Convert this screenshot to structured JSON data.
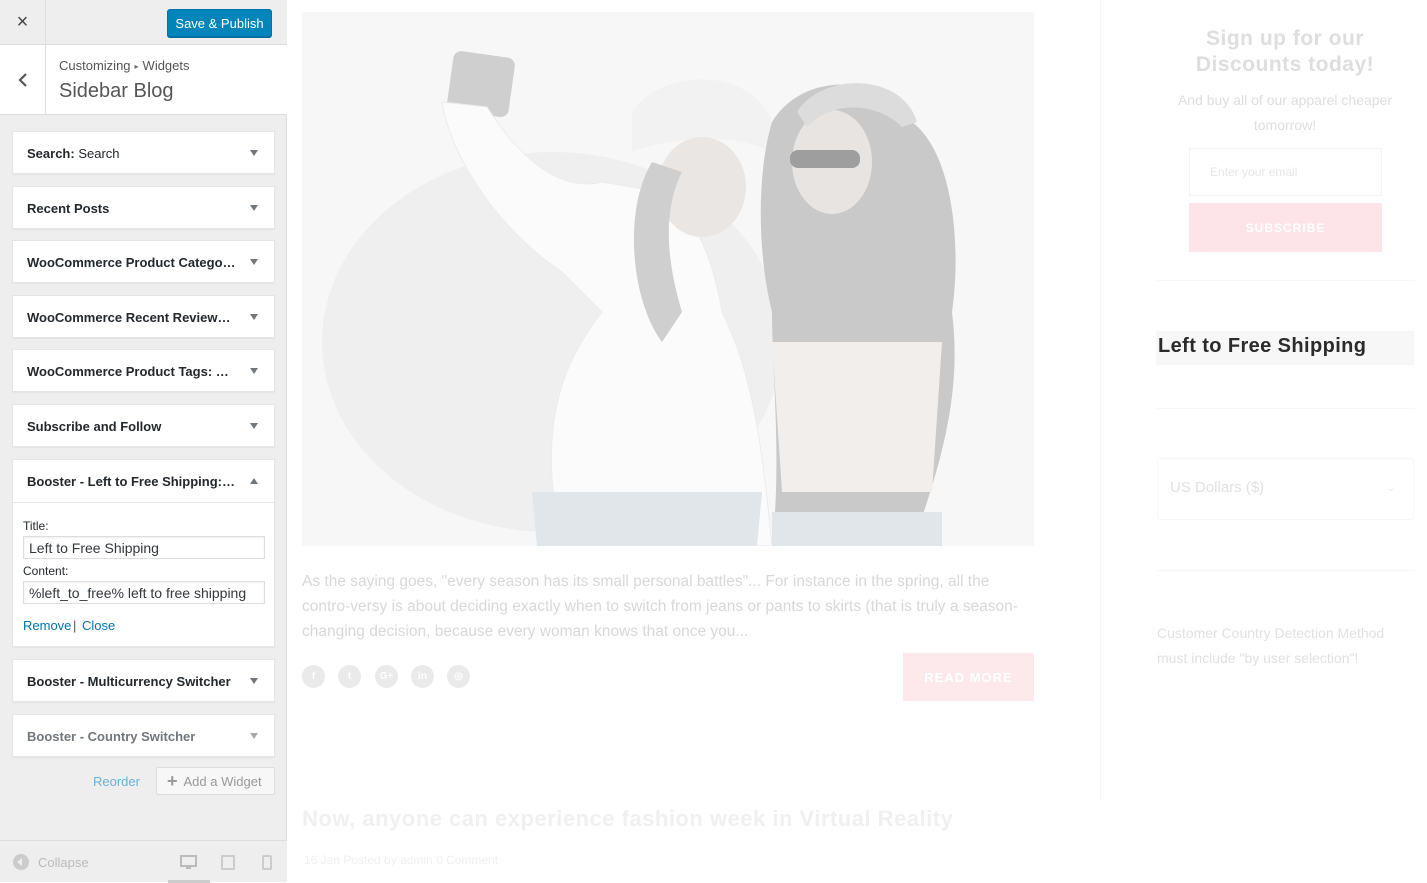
{
  "topbar": {
    "close_icon": "×",
    "publish_label": "Save & Publish"
  },
  "header": {
    "breadcrumb_root": "Customizing",
    "breadcrumb_sep": "▸",
    "breadcrumb_section": "Widgets",
    "title": "Sidebar Blog"
  },
  "widgets": [
    {
      "title": "Search:",
      "subtitle": "Search"
    },
    {
      "title": "Recent Posts",
      "subtitle": ""
    },
    {
      "title": "WooCommerce Product Categor...",
      "subtitle": ""
    },
    {
      "title": "WooCommerce Recent Reviews: ...",
      "subtitle": ""
    },
    {
      "title": "WooCommerce Product Tags: Pr...",
      "subtitle": ""
    },
    {
      "title": "Subscribe and Follow",
      "subtitle": ""
    },
    {
      "title": "Booster - Left to Free Shipping: L...",
      "subtitle": ""
    },
    {
      "title": "Booster - Multicurrency Switcher",
      "subtitle": ""
    },
    {
      "title": "Booster - Country Switcher",
      "subtitle": ""
    }
  ],
  "open_widget": {
    "title_label": "Title:",
    "title_value": "Left to Free Shipping",
    "content_label": "Content:",
    "content_value": "%left_to_free% left to free shipping",
    "remove_label": "Remove",
    "link_sep": "|",
    "close_label": "Close"
  },
  "actions": {
    "reorder_label": "Reorder",
    "add_widget_label": "Add a Widget",
    "add_icon": "+"
  },
  "footer": {
    "collapse_label": "Collapse"
  },
  "preview": {
    "excerpt": "As the saying goes, \"every season has its small personal battles\"... For instance in the spring, all the contro-versy is about deciding exactly when to switch from jeans or pants to skirts (that is truly a season-changing decision, because every woman knows that once you...",
    "social_icons": [
      "f",
      "t",
      "G+",
      "in",
      "◎"
    ],
    "read_more": "READ MORE",
    "post2_title": "Now, anyone can experience fashion week in Virtual Reality",
    "post2_meta": "16 Jan Posted by admin 0 Comment",
    "signup_title": "Sign up for our Discounts today!",
    "signup_text": "And buy all of our apparel cheaper tomorrow!",
    "email_placeholder": "Enter your email",
    "subscribe_label": "SUBSCRIBE",
    "shipping_title": "Left to Free Shipping",
    "currency_value": "US Dollars ($)",
    "country_note": "Customer Country Detection Method must include \"by user selection\"!"
  },
  "colors": {
    "primary_button": "#0085ba",
    "link": "#0073aa",
    "accent_pink": "#fde4e8"
  }
}
